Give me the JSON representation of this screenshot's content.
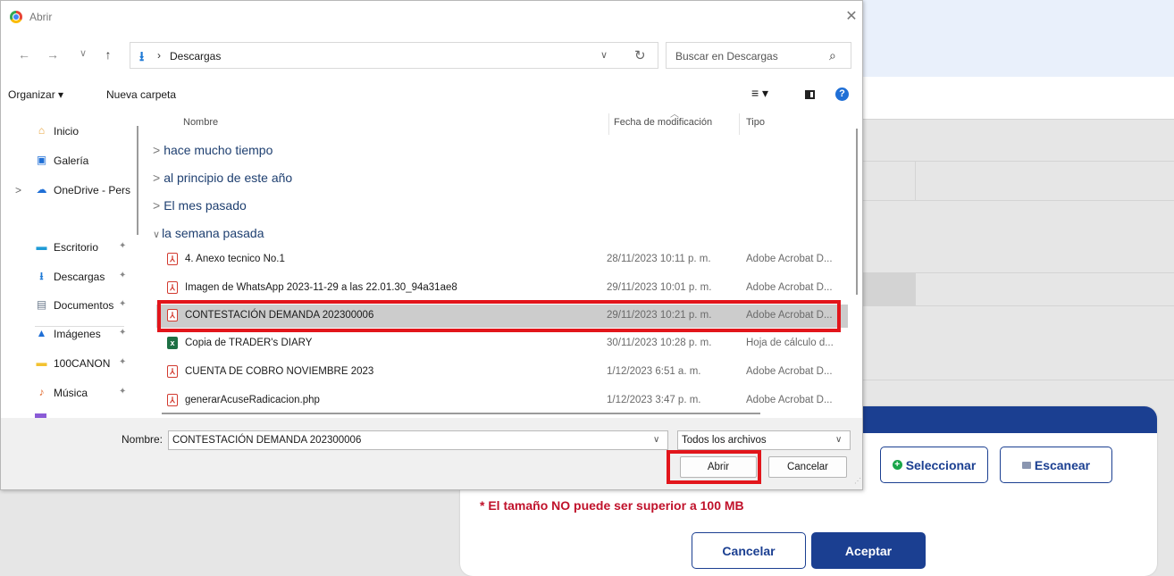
{
  "dialog": {
    "title": "Abrir",
    "close": "✕",
    "nav": {
      "back": "←",
      "forward": "→",
      "recent": "∨",
      "up": "↑"
    },
    "address": {
      "separator": "›",
      "location": "Descargas",
      "chevron": "∨",
      "refresh": "↻"
    },
    "search": {
      "placeholder": "Buscar en Descargas",
      "icon": "search-icon"
    },
    "toolbar": {
      "organize": "Organizar ▾",
      "new_folder": "Nueva carpeta",
      "view": "≡ ▾",
      "help": "?"
    },
    "sidebar": [
      {
        "label": "Inicio",
        "icon": "home-icon",
        "glyph": "⌂",
        "color": "#e8a33a"
      },
      {
        "label": "Galería",
        "icon": "gallery-icon",
        "glyph": "▣",
        "color": "#1f6fd6"
      },
      {
        "label": "OneDrive - Pers",
        "icon": "onedrive-icon",
        "glyph": "☁",
        "color": "#1f6fd6",
        "expand": ">"
      },
      {
        "label": "Escritorio",
        "icon": "desktop-icon",
        "glyph": "▬",
        "color": "#1f9bd6",
        "pin": "📌"
      },
      {
        "label": "Descargas",
        "icon": "downloads-icon",
        "glyph": "⭳",
        "color": "#1f7ad6",
        "pin": "📌"
      },
      {
        "label": "Documentos",
        "icon": "documents-icon",
        "glyph": "▤",
        "color": "#6b7a8c",
        "pin": "📌"
      },
      {
        "label": "Imágenes",
        "icon": "pictures-icon",
        "glyph": "▲",
        "color": "#1f6fd6",
        "pin": "📌"
      },
      {
        "label": "100CANON",
        "icon": "folder-icon",
        "glyph": "▬",
        "color": "#f2c230",
        "pin": "📌"
      },
      {
        "label": "Música",
        "icon": "music-icon",
        "glyph": "♪",
        "color": "#e0672a",
        "pin": "📌"
      }
    ],
    "columns": {
      "name": "Nombre",
      "date": "Fecha de modificación",
      "type": "Tipo",
      "sort_indicator": "︿"
    },
    "groups": [
      {
        "label": "hace mucho tiempo",
        "chevron": ">"
      },
      {
        "label": "al principio de este año",
        "chevron": ">"
      },
      {
        "label": "El mes pasado",
        "chevron": ">"
      },
      {
        "label": "la semana pasada",
        "chevron": "∨"
      }
    ],
    "files": [
      {
        "name": "4. Anexo tecnico No.1",
        "date": "28/11/2023 10:11 p. m.",
        "type": "Adobe Acrobat D...",
        "kind": "pdf"
      },
      {
        "name": "Imagen de WhatsApp 2023-11-29 a las 22.01.30_94a31ae8",
        "date": "29/11/2023 10:01 p. m.",
        "type": "Adobe Acrobat D...",
        "kind": "pdf"
      },
      {
        "name": "CONTESTACIÓN DEMANDA 202300006",
        "date": "29/11/2023 10:21 p. m.",
        "type": "Adobe Acrobat D...",
        "kind": "pdf",
        "selected": true
      },
      {
        "name": "Copia de TRADER's DIARY",
        "date": "30/11/2023 10:28 p. m.",
        "type": "Hoja de cálculo d...",
        "kind": "xlsx"
      },
      {
        "name": "CUENTA DE COBRO NOVIEMBRE 2023",
        "date": "1/12/2023 6:51 a. m.",
        "type": "Adobe Acrobat D...",
        "kind": "pdf"
      },
      {
        "name": "generarAcuseRadicacion.php",
        "date": "1/12/2023 3:47 p. m.",
        "type": "Adobe Acrobat D...",
        "kind": "pdf"
      }
    ],
    "filename": {
      "label": "Nombre:",
      "value": "CONTESTACIÓN DEMANDA 202300006"
    },
    "filter": {
      "value": "Todos los archivos"
    },
    "buttons": {
      "open": "Abrir",
      "cancel": "Cancelar"
    }
  },
  "modal": {
    "select_button": "Seleccionar",
    "scan_button": "Escanear",
    "size_warning": "* El tamaño NO puede ser superior a 100 MB",
    "cancel_button": "Cancelar",
    "accept_button": "Aceptar"
  },
  "colors": {
    "brand": "#1b3f91",
    "warning": "#c0122b",
    "highlight": "#e2151b"
  }
}
